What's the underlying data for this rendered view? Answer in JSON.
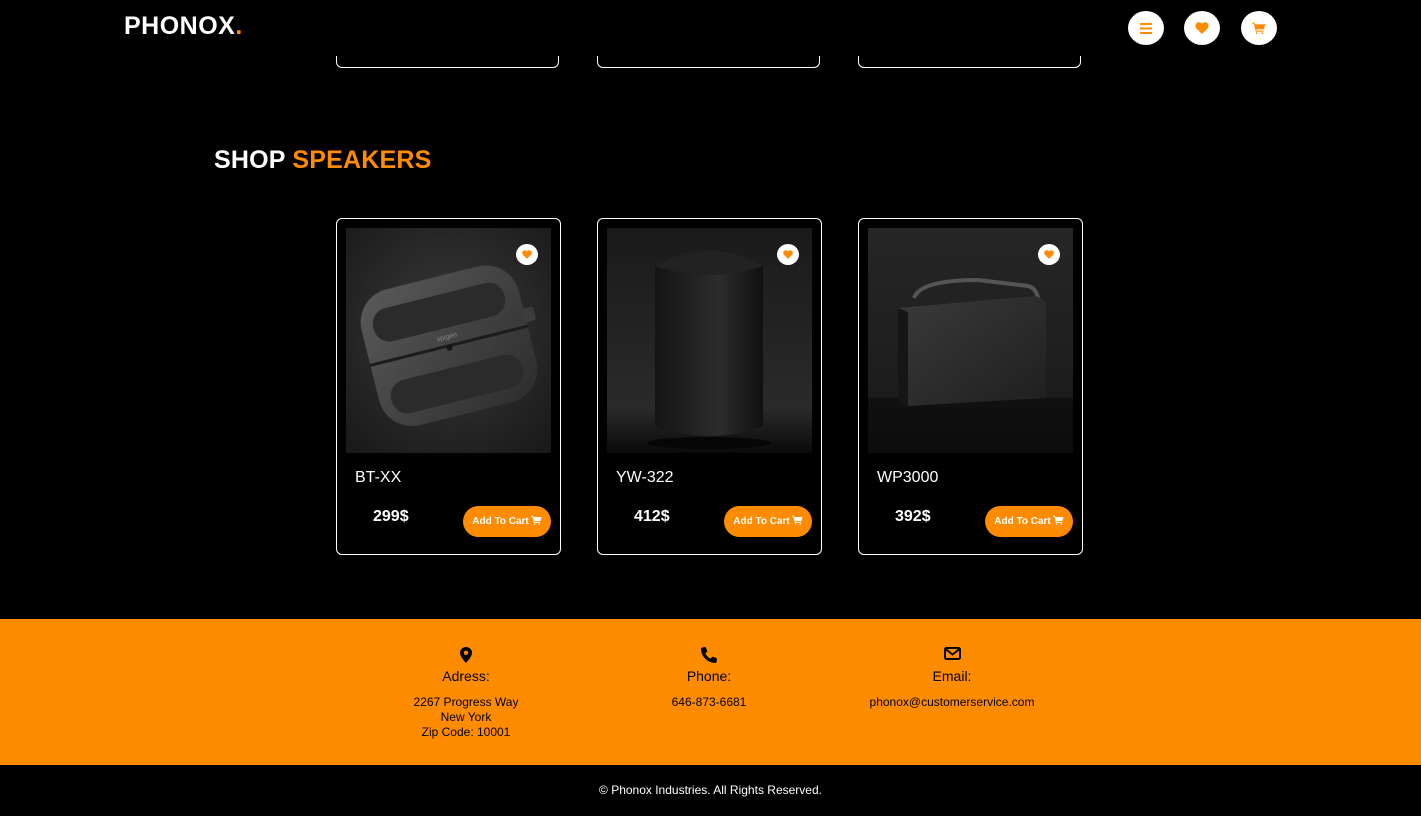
{
  "brand": {
    "name": "PHONOX",
    "dot": ".",
    "accent": "#ff8c00"
  },
  "header": {
    "icons": [
      "menu-icon",
      "heart-icon",
      "cart-icon"
    ]
  },
  "section": {
    "title_white": "SHOP",
    "title_orange": "SPEAKERS"
  },
  "products": [
    {
      "name": "BT-XX",
      "price": "299$",
      "button": "Add To Cart"
    },
    {
      "name": "YW-322",
      "price": "412$",
      "button": "Add To Cart"
    },
    {
      "name": "WP3000",
      "price": "392$",
      "button": "Add To Cart"
    }
  ],
  "footer": {
    "address": {
      "label": "Adress:",
      "line1": "2267 Progress Way",
      "line2": "New York",
      "line3": "Zip Code: 10001"
    },
    "phone": {
      "label": "Phone:",
      "value": "646-873-6681"
    },
    "email": {
      "label": "Email:",
      "value": "phonox@customerservice.com"
    },
    "copyright": "© Phonox Industries. All Rights Reserved."
  }
}
